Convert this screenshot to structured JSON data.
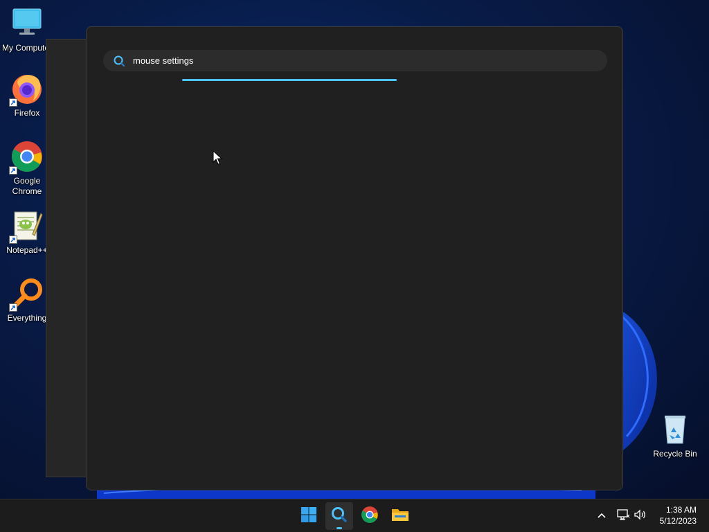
{
  "desktop": {
    "icons": [
      {
        "label": "My Computer",
        "icon": "monitor-icon"
      },
      {
        "label": "Firefox",
        "icon": "firefox-icon"
      },
      {
        "label": "Google Chrome",
        "icon": "chrome-icon"
      },
      {
        "label": "Notepad++",
        "icon": "notepadpp-icon"
      },
      {
        "label": "Everything",
        "icon": "everything-icon"
      },
      {
        "label": "Recycle Bin",
        "icon": "recycle-bin-icon"
      }
    ]
  },
  "search": {
    "query": "mouse settings",
    "icon": "search-icon",
    "accent": "#4cc2ff"
  },
  "taskbar": {
    "apps": [
      "start-icon",
      "search-icon",
      "chrome-icon",
      "file-explorer-icon"
    ],
    "tray": [
      "chevron-up-icon",
      "network-icon",
      "volume-icon"
    ],
    "time": "1:38 AM",
    "date": "5/12/2023"
  }
}
